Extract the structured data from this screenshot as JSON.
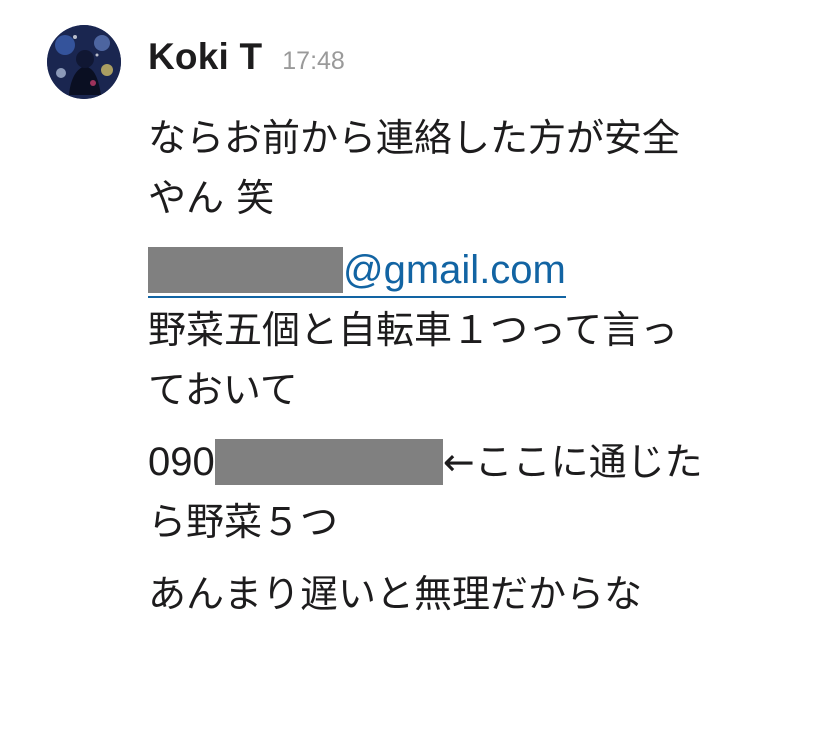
{
  "message": {
    "sender": "Koki T",
    "timestamp": "17:48",
    "avatar_icon": "avatar-photo",
    "paragraphs": {
      "p1": {
        "line1": "ならお前から連絡した方が安全",
        "line2": "やん 笑"
      },
      "p2": {
        "email_domain": "@gmail.com",
        "line2": "野菜五個と自転車１つって言っ",
        "line3": "ておいて"
      },
      "p3": {
        "phone_prefix": "090",
        "line1_suffix": "←ここに通じた",
        "line2": "ら野菜５つ"
      },
      "p4": {
        "line1": "あんまり遅いと無理だからな"
      }
    },
    "colors": {
      "link": "#1264a3",
      "redaction": "#808080",
      "timestamp": "#9a9a9a",
      "text": "#1d1c1d"
    }
  }
}
